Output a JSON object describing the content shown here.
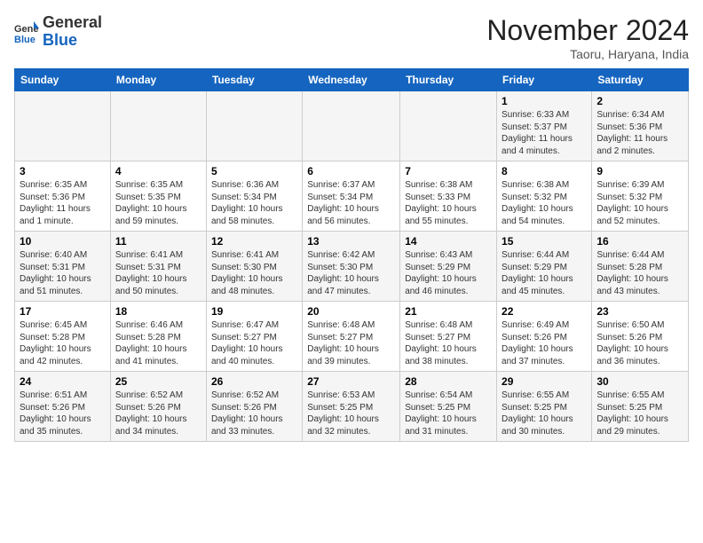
{
  "header": {
    "logo_general": "General",
    "logo_blue": "Blue",
    "month_title": "November 2024",
    "location": "Taoru, Haryana, India"
  },
  "days_of_week": [
    "Sunday",
    "Monday",
    "Tuesday",
    "Wednesday",
    "Thursday",
    "Friday",
    "Saturday"
  ],
  "weeks": [
    [
      {
        "day": "",
        "info": ""
      },
      {
        "day": "",
        "info": ""
      },
      {
        "day": "",
        "info": ""
      },
      {
        "day": "",
        "info": ""
      },
      {
        "day": "",
        "info": ""
      },
      {
        "day": "1",
        "info": "Sunrise: 6:33 AM\nSunset: 5:37 PM\nDaylight: 11 hours and 4 minutes."
      },
      {
        "day": "2",
        "info": "Sunrise: 6:34 AM\nSunset: 5:36 PM\nDaylight: 11 hours and 2 minutes."
      }
    ],
    [
      {
        "day": "3",
        "info": "Sunrise: 6:35 AM\nSunset: 5:36 PM\nDaylight: 11 hours and 1 minute."
      },
      {
        "day": "4",
        "info": "Sunrise: 6:35 AM\nSunset: 5:35 PM\nDaylight: 10 hours and 59 minutes."
      },
      {
        "day": "5",
        "info": "Sunrise: 6:36 AM\nSunset: 5:34 PM\nDaylight: 10 hours and 58 minutes."
      },
      {
        "day": "6",
        "info": "Sunrise: 6:37 AM\nSunset: 5:34 PM\nDaylight: 10 hours and 56 minutes."
      },
      {
        "day": "7",
        "info": "Sunrise: 6:38 AM\nSunset: 5:33 PM\nDaylight: 10 hours and 55 minutes."
      },
      {
        "day": "8",
        "info": "Sunrise: 6:38 AM\nSunset: 5:32 PM\nDaylight: 10 hours and 54 minutes."
      },
      {
        "day": "9",
        "info": "Sunrise: 6:39 AM\nSunset: 5:32 PM\nDaylight: 10 hours and 52 minutes."
      }
    ],
    [
      {
        "day": "10",
        "info": "Sunrise: 6:40 AM\nSunset: 5:31 PM\nDaylight: 10 hours and 51 minutes."
      },
      {
        "day": "11",
        "info": "Sunrise: 6:41 AM\nSunset: 5:31 PM\nDaylight: 10 hours and 50 minutes."
      },
      {
        "day": "12",
        "info": "Sunrise: 6:41 AM\nSunset: 5:30 PM\nDaylight: 10 hours and 48 minutes."
      },
      {
        "day": "13",
        "info": "Sunrise: 6:42 AM\nSunset: 5:30 PM\nDaylight: 10 hours and 47 minutes."
      },
      {
        "day": "14",
        "info": "Sunrise: 6:43 AM\nSunset: 5:29 PM\nDaylight: 10 hours and 46 minutes."
      },
      {
        "day": "15",
        "info": "Sunrise: 6:44 AM\nSunset: 5:29 PM\nDaylight: 10 hours and 45 minutes."
      },
      {
        "day": "16",
        "info": "Sunrise: 6:44 AM\nSunset: 5:28 PM\nDaylight: 10 hours and 43 minutes."
      }
    ],
    [
      {
        "day": "17",
        "info": "Sunrise: 6:45 AM\nSunset: 5:28 PM\nDaylight: 10 hours and 42 minutes."
      },
      {
        "day": "18",
        "info": "Sunrise: 6:46 AM\nSunset: 5:28 PM\nDaylight: 10 hours and 41 minutes."
      },
      {
        "day": "19",
        "info": "Sunrise: 6:47 AM\nSunset: 5:27 PM\nDaylight: 10 hours and 40 minutes."
      },
      {
        "day": "20",
        "info": "Sunrise: 6:48 AM\nSunset: 5:27 PM\nDaylight: 10 hours and 39 minutes."
      },
      {
        "day": "21",
        "info": "Sunrise: 6:48 AM\nSunset: 5:27 PM\nDaylight: 10 hours and 38 minutes."
      },
      {
        "day": "22",
        "info": "Sunrise: 6:49 AM\nSunset: 5:26 PM\nDaylight: 10 hours and 37 minutes."
      },
      {
        "day": "23",
        "info": "Sunrise: 6:50 AM\nSunset: 5:26 PM\nDaylight: 10 hours and 36 minutes."
      }
    ],
    [
      {
        "day": "24",
        "info": "Sunrise: 6:51 AM\nSunset: 5:26 PM\nDaylight: 10 hours and 35 minutes."
      },
      {
        "day": "25",
        "info": "Sunrise: 6:52 AM\nSunset: 5:26 PM\nDaylight: 10 hours and 34 minutes."
      },
      {
        "day": "26",
        "info": "Sunrise: 6:52 AM\nSunset: 5:26 PM\nDaylight: 10 hours and 33 minutes."
      },
      {
        "day": "27",
        "info": "Sunrise: 6:53 AM\nSunset: 5:25 PM\nDaylight: 10 hours and 32 minutes."
      },
      {
        "day": "28",
        "info": "Sunrise: 6:54 AM\nSunset: 5:25 PM\nDaylight: 10 hours and 31 minutes."
      },
      {
        "day": "29",
        "info": "Sunrise: 6:55 AM\nSunset: 5:25 PM\nDaylight: 10 hours and 30 minutes."
      },
      {
        "day": "30",
        "info": "Sunrise: 6:55 AM\nSunset: 5:25 PM\nDaylight: 10 hours and 29 minutes."
      }
    ]
  ]
}
